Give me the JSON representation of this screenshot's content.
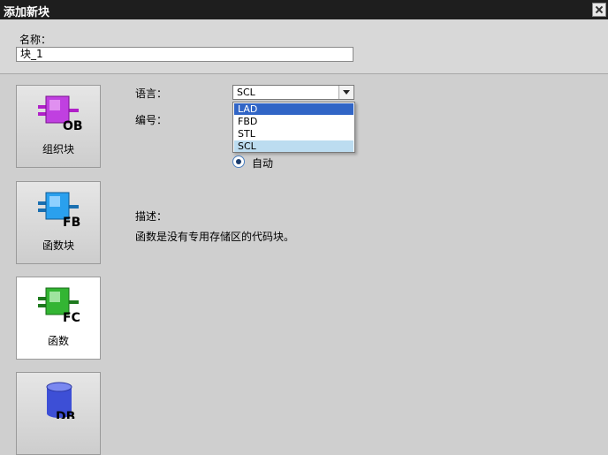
{
  "window": {
    "title": "添加新块"
  },
  "name_field": {
    "label": "名称：",
    "value": "块_1"
  },
  "blocks": [
    {
      "label": "组织块",
      "tag": "OB",
      "color": "#b020c8"
    },
    {
      "label": "函数块",
      "tag": "FB",
      "color": "#1a8fe0"
    },
    {
      "label": "函数",
      "tag": "FC",
      "color": "#2aa62a"
    },
    {
      "label": "",
      "tag": "DB",
      "color": "#3d4fd6"
    }
  ],
  "language": {
    "label": "语言：",
    "selected": "SCL",
    "options": [
      "LAD",
      "FBD",
      "STL",
      "SCL"
    ],
    "highlighted": "LAD"
  },
  "number": {
    "label": "编号：",
    "mode": "自动"
  },
  "description": {
    "label": "描述：",
    "text": "函数是没有专用存储区的代码块。"
  },
  "colors": {
    "titlebar": "#1e1e1e",
    "highlight": "#3165c6",
    "current_option": "#bcdcf0"
  }
}
